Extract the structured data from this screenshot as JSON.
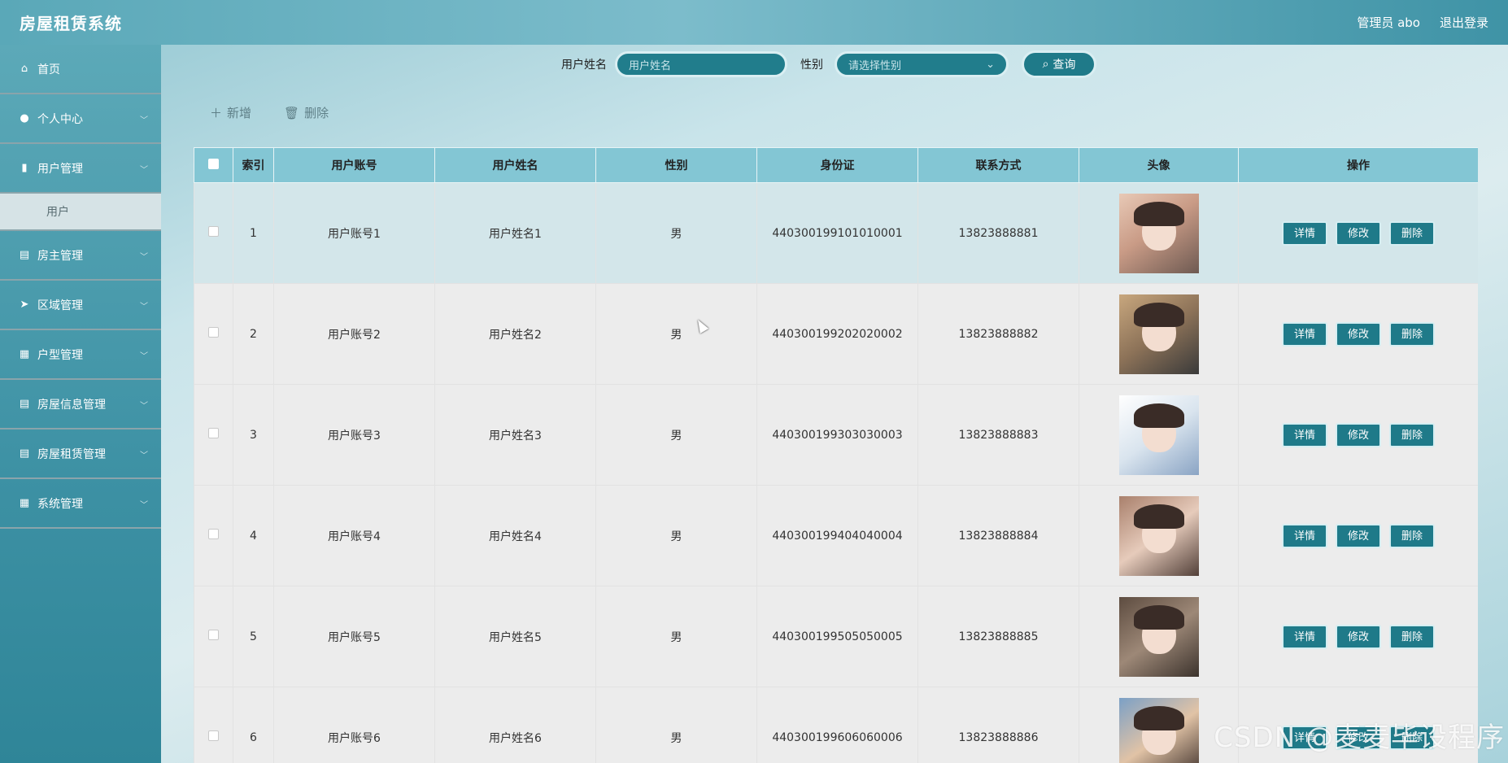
{
  "app": {
    "title": "房屋租赁系统"
  },
  "header": {
    "admin_label": "管理员 abo",
    "logout_label": "退出登录"
  },
  "sidebar": {
    "items": [
      {
        "label": "首页",
        "icon": "home-icon",
        "has_children": false
      },
      {
        "label": "个人中心",
        "icon": "user-icon",
        "has_children": true
      },
      {
        "label": "用户管理",
        "icon": "bar-chart-icon",
        "has_children": true,
        "expanded": true,
        "children": [
          {
            "label": "用户"
          }
        ]
      },
      {
        "label": "房主管理",
        "icon": "clipboard-icon",
        "has_children": true
      },
      {
        "label": "区域管理",
        "icon": "send-icon",
        "has_children": true
      },
      {
        "label": "户型管理",
        "icon": "grid-icon",
        "has_children": true
      },
      {
        "label": "房屋信息管理",
        "icon": "clipboard-icon",
        "has_children": true
      },
      {
        "label": "房屋租赁管理",
        "icon": "clipboard-icon",
        "has_children": true
      },
      {
        "label": "系统管理",
        "icon": "grid-icon",
        "has_children": true
      }
    ]
  },
  "search": {
    "name_label": "用户姓名",
    "name_placeholder": "用户姓名",
    "gender_label": "性别",
    "gender_placeholder": "请选择性别",
    "query_label": "查询"
  },
  "toolbar": {
    "add_label": "新增",
    "delete_label": "删除"
  },
  "table": {
    "headers": [
      "",
      "索引",
      "用户账号",
      "用户姓名",
      "性别",
      "身份证",
      "联系方式",
      "头像",
      "操作"
    ],
    "actions": {
      "detail": "详情",
      "edit": "修改",
      "delete": "删除"
    },
    "rows": [
      {
        "index": "1",
        "account": "用户账号1",
        "name": "用户姓名1",
        "gender": "男",
        "id_card": "440300199101010001",
        "phone": "13823888881"
      },
      {
        "index": "2",
        "account": "用户账号2",
        "name": "用户姓名2",
        "gender": "男",
        "id_card": "440300199202020002",
        "phone": "13823888882"
      },
      {
        "index": "3",
        "account": "用户账号3",
        "name": "用户姓名3",
        "gender": "男",
        "id_card": "440300199303030003",
        "phone": "13823888883"
      },
      {
        "index": "4",
        "account": "用户账号4",
        "name": "用户姓名4",
        "gender": "男",
        "id_card": "440300199404040004",
        "phone": "13823888884"
      },
      {
        "index": "5",
        "account": "用户账号5",
        "name": "用户姓名5",
        "gender": "男",
        "id_card": "440300199505050005",
        "phone": "13823888885"
      },
      {
        "index": "6",
        "account": "用户账号6",
        "name": "用户姓名6",
        "gender": "男",
        "id_card": "440300199606060006",
        "phone": "13823888886"
      }
    ]
  },
  "watermark": "CSDN @麦麦毕设程序",
  "colors": {
    "accent": "#1f7a89",
    "header_bg": "#83c6d4",
    "sidebar": "#3d91a4"
  }
}
